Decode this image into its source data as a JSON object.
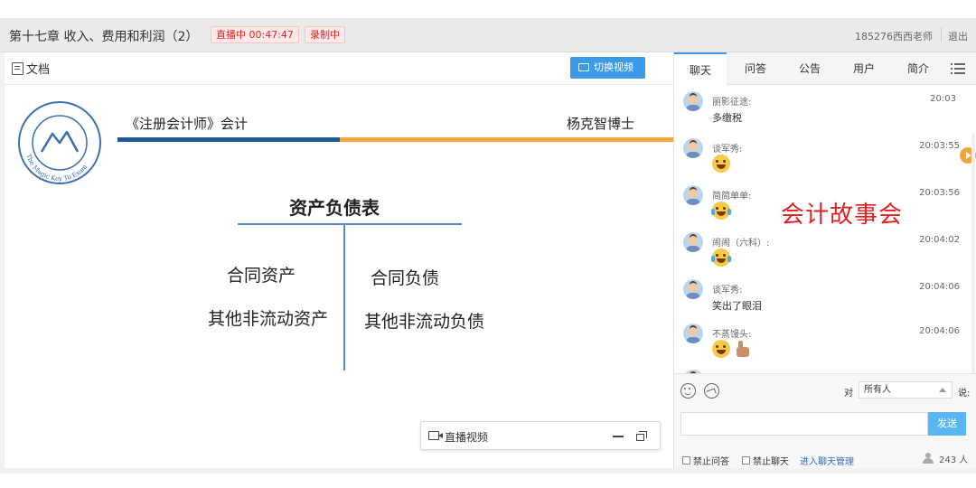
{
  "header": {
    "course_title": "第十七章 收入、费用和利润（2）",
    "live_badge": "直播中 00:47:47",
    "record_badge": "录制中",
    "user_name": "185276西西老师",
    "logout_label": "退出"
  },
  "doc": {
    "tab_label": "文档",
    "switch_video_label": "切换视频"
  },
  "slide": {
    "subject": "《注册会计师》会计",
    "author": "杨克智博士",
    "bs_title": "资产负债表",
    "left_items": [
      "合同资产",
      "其他非流动资产"
    ],
    "right_items": [
      "合同负债",
      "其他非流动负债"
    ],
    "logo_text": "The Magic Key To Exam"
  },
  "live_video": {
    "label": "直播视频"
  },
  "chat": {
    "tabs": [
      "聊天",
      "问答",
      "公告",
      "用户",
      "简介"
    ],
    "active_tab": "聊天",
    "messages": [
      {
        "name": "丽影征途:",
        "time": "20:03",
        "text": "多缴税"
      },
      {
        "name": "谈军秀:",
        "time": "20:03:55",
        "emoji": "grin"
      },
      {
        "name": "简简单单:",
        "time": "20:03:56",
        "emoji": "tears-of-joy"
      },
      {
        "name": "闹闹（六科）:",
        "time": "20:04:02",
        "emoji": "tears-of-joy"
      },
      {
        "name": "谈军秀:",
        "time": "20:04:06",
        "text": "笑出了眼泪"
      },
      {
        "name": "不蒸馒头:",
        "time": "20:04:06",
        "emoji": "grin thumbs-up"
      }
    ],
    "overlay_text": "会计故事会",
    "to_label": "对",
    "recipient": "所有人",
    "say_label": "说:",
    "input_placeholder": "",
    "send_label": "发送",
    "disable_qa_label": "禁止问答",
    "disable_chat_label": "禁止聊天",
    "manage_link": "进入聊天管理",
    "online_count": "243 人"
  },
  "colors": {
    "accent_blue": "#3b9be8",
    "slide_blue": "#1f5a96",
    "slide_orange": "#f1a541",
    "badge_red": "#dd2222",
    "overlay_red": "#e02020"
  }
}
